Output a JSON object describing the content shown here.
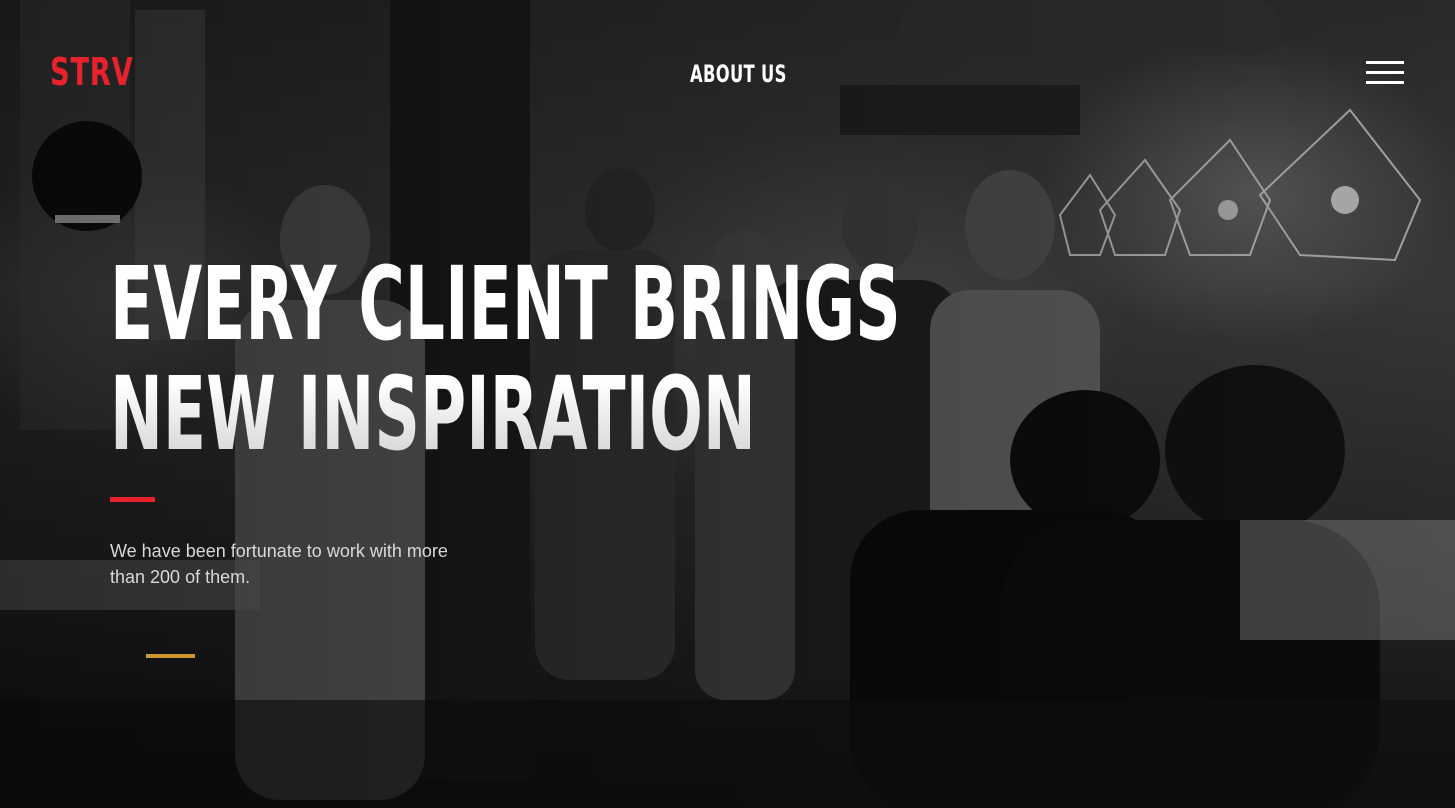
{
  "header": {
    "logo_text": "STRV",
    "nav_title": "ABOUT US",
    "menu_icon": "hamburger-menu-icon"
  },
  "hero": {
    "headline_line1": "EVERY CLIENT BRINGS",
    "headline_line2": "NEW INSPIRATION",
    "subtext": "We have been fortunate to work with more than 200 of them."
  },
  "colors": {
    "brand_red": "#e8222d",
    "accent_gold": "#c9992e",
    "text_white": "#ffffff"
  }
}
